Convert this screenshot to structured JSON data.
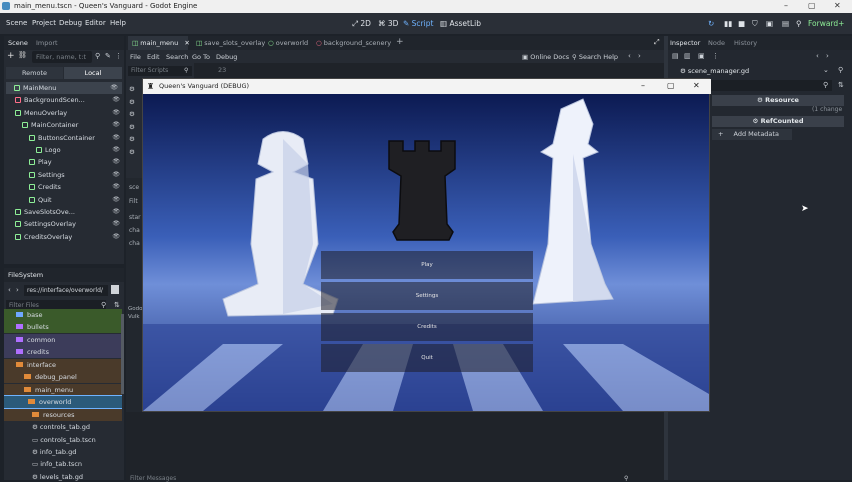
{
  "window": {
    "title": "main_menu.tscn - Queen's Vanguard - Godot Engine"
  },
  "menu": [
    "Scene",
    "Project",
    "Debug",
    "Editor",
    "Help"
  ],
  "top_modes": [
    "2D",
    "3D",
    "Script",
    "AssetLib"
  ],
  "renderer": "Forward+",
  "scene_dock": {
    "tabs": [
      "Scene",
      "Import"
    ],
    "filter_placeholder": "Filter, name, t:t",
    "view_tabs": [
      "Remote",
      "Local"
    ],
    "nodes": [
      {
        "name": "MainMenu",
        "indent": 0
      },
      {
        "name": "BackgroundScen...",
        "indent": 1
      },
      {
        "name": "MenuOverlay",
        "indent": 1
      },
      {
        "name": "MainContainer",
        "indent": 2
      },
      {
        "name": "ButtonsContainer",
        "indent": 3
      },
      {
        "name": "Logo",
        "indent": 4
      },
      {
        "name": "Play",
        "indent": 3
      },
      {
        "name": "Settings",
        "indent": 3
      },
      {
        "name": "Credits",
        "indent": 3
      },
      {
        "name": "Quit",
        "indent": 3
      },
      {
        "name": "SaveSlotsOve...",
        "indent": 1
      },
      {
        "name": "SettingsOverlay",
        "indent": 1
      },
      {
        "name": "CreditsOverlay",
        "indent": 1
      }
    ]
  },
  "filesystem": {
    "title": "FileSystem",
    "path": "res://interface/overworld/",
    "filter_placeholder": "Filter Files",
    "items": [
      {
        "name": "base",
        "type": "folder"
      },
      {
        "name": "bullets",
        "type": "folder"
      },
      {
        "name": "common",
        "type": "folder"
      },
      {
        "name": "credits",
        "type": "folder"
      },
      {
        "name": "interface",
        "type": "folder"
      },
      {
        "name": "debug_panel",
        "type": "folder"
      },
      {
        "name": "main_menu",
        "type": "folder"
      },
      {
        "name": "overworld",
        "type": "folder"
      },
      {
        "name": "resources",
        "type": "folder"
      },
      {
        "name": "controls_tab.gd",
        "type": "file"
      },
      {
        "name": "controls_tab.tscn",
        "type": "file"
      },
      {
        "name": "info_tab.gd",
        "type": "file"
      },
      {
        "name": "info_tab.tscn",
        "type": "file"
      },
      {
        "name": "levels_tab.gd",
        "type": "file"
      }
    ]
  },
  "editor_tabs": [
    "main_menu",
    "save_slots_overlay",
    "overworld",
    "background_scenery"
  ],
  "script_menu": [
    "File",
    "Edit",
    "Search",
    "Go To",
    "Debug"
  ],
  "script_right": [
    "Online Docs",
    "Search Help"
  ],
  "filter_scripts": "Filter Scripts",
  "line_number": "23",
  "script_list_partial": [
    "sce",
    "Filt",
    "star",
    "cha",
    "cha"
  ],
  "output_partial": [
    "Godo",
    "Vulk"
  ],
  "filter_messages": "Filter Messages",
  "game": {
    "title": "Queen's Vanguard (DEBUG)",
    "buttons": [
      "Play",
      "Settings",
      "Credits",
      "Quit"
    ]
  },
  "inspector": {
    "tabs": [
      "Inspector",
      "Node",
      "History"
    ],
    "file": "scene_manager.gd",
    "sections": [
      "Resource",
      "RefCounted"
    ],
    "change_note": "(1 change",
    "add_metadata": "Add Metadata"
  },
  "colors": {
    "accent": "#478cbf",
    "green": "#8eef97",
    "bg": "#1d2229"
  }
}
